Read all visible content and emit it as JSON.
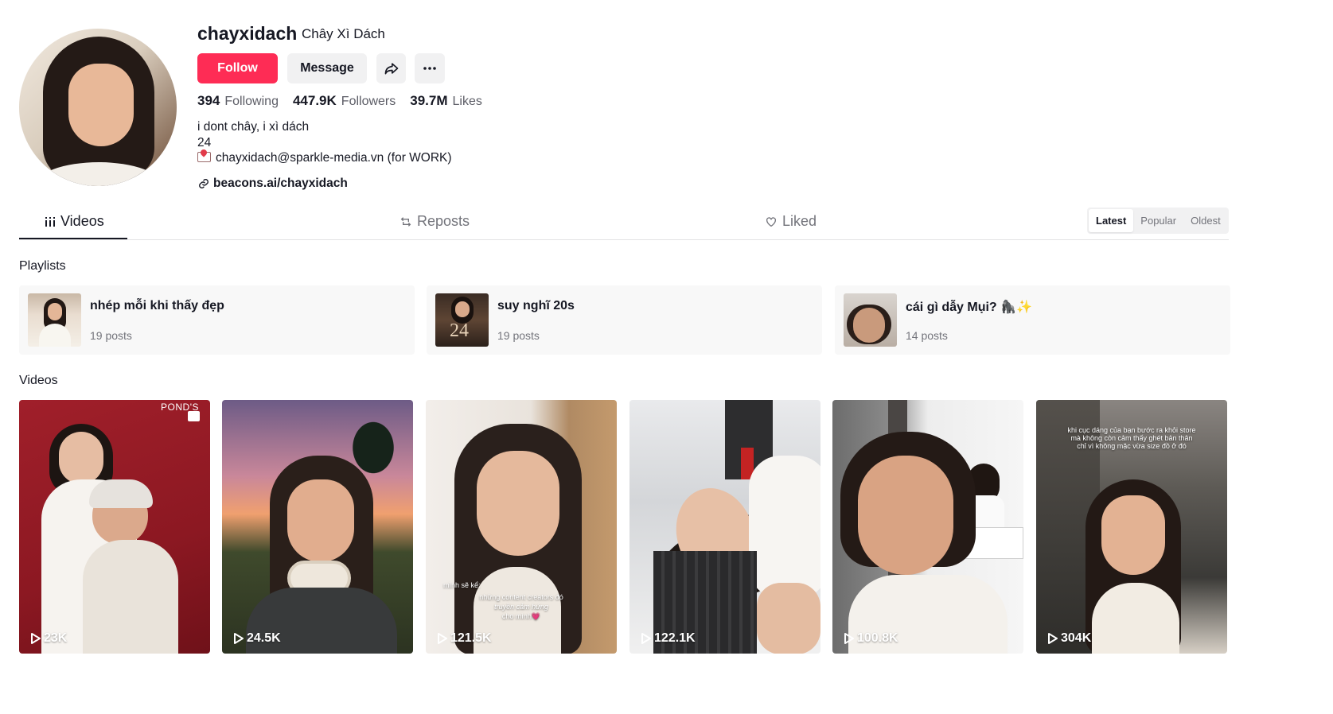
{
  "profile": {
    "username": "chayxidach",
    "nickname": "Chây Xì Dách",
    "follow_label": "Follow",
    "message_label": "Message",
    "stats": [
      {
        "value": "394",
        "label": "Following"
      },
      {
        "value": "447.9K",
        "label": "Followers"
      },
      {
        "value": "39.7M",
        "label": "Likes"
      }
    ],
    "bio": {
      "line1": "i dont chây, i xì dách",
      "line2": "24",
      "line3": "chayxidach@sparkle-media.vn (for WORK)"
    },
    "link": "beacons.ai/chayxidach"
  },
  "tabs": {
    "videos": "Videos",
    "reposts": "Reposts",
    "liked": "Liked"
  },
  "sort": {
    "options": [
      "Latest",
      "Popular",
      "Oldest"
    ],
    "selected": "Latest"
  },
  "sections": {
    "playlists": "Playlists",
    "videos": "Videos"
  },
  "playlists": [
    {
      "title": "nhép mỗi khi thấy đẹp",
      "count": "19 posts"
    },
    {
      "title": "suy nghĩ 20s",
      "count": "19 posts"
    },
    {
      "title": "cái gì dẫy Mụi? 🦍✨",
      "count": "14 posts"
    }
  ],
  "videos": [
    {
      "views": "23K",
      "overlay": "POND'S"
    },
    {
      "views": "24.5K"
    },
    {
      "views": "121.5K",
      "caption1": "mình sẽ kể:",
      "caption2": "những content creators đó",
      "caption3": "truyền cảm hứng",
      "caption4": "cho mình💗"
    },
    {
      "views": "122.1K"
    },
    {
      "views": "100.8K"
    },
    {
      "views": "304K",
      "caption1": "khi cục dáng của bạn bước ra khỏi store",
      "caption2": "mà không còn cảm thấy ghét bản thân",
      "caption3": "chỉ vì không mặc vừa size đồ ở đó"
    }
  ],
  "colors": {
    "accent": "#fe2c55",
    "text": "#161823",
    "muted": "#73747b",
    "button_bg": "#f1f1f2"
  }
}
